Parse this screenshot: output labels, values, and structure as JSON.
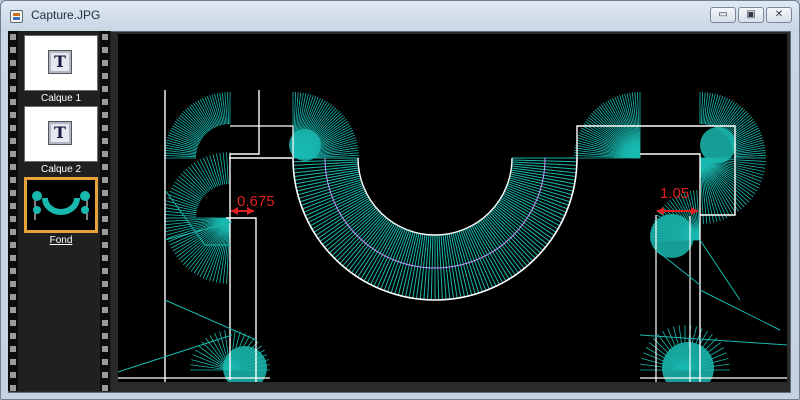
{
  "window": {
    "title": "Capture.JPG",
    "controls": {
      "minimize": "▭",
      "maximize": "▣",
      "close": "✕"
    }
  },
  "layers": [
    {
      "label": "Calque 1",
      "icon": "T",
      "selected": false
    },
    {
      "label": "Calque 2",
      "icon": "T",
      "selected": false
    },
    {
      "label": "Fond",
      "selected": true
    }
  ],
  "drawing": {
    "dimensions": [
      {
        "label": "0.675"
      },
      {
        "label": "1.05"
      }
    ],
    "colors": {
      "background": "#000000",
      "hatch": "#19b9b0",
      "outline": "#ffffff",
      "centerline": "#c79cff",
      "dimension": "#e02020"
    }
  }
}
